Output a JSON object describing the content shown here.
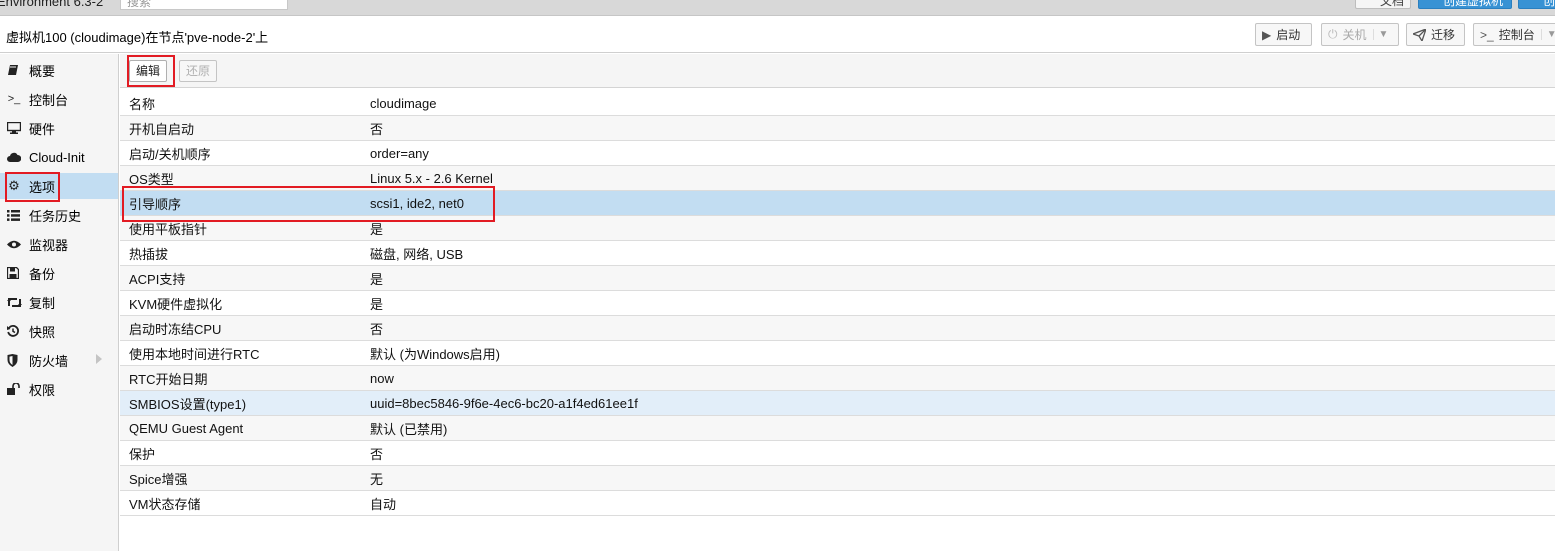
{
  "topbar": {
    "env_text": "Environment 6.3-2",
    "search_placeholder": "搜索",
    "btn_docs": "文档",
    "btn_create_vm": "创建虚拟机",
    "btn_create_ct": "创"
  },
  "titlebar": {
    "title": "虚拟机100 (cloudimage)在节点'pve-node-2'上",
    "start_label": "启动",
    "shutdown_label": "关机",
    "migrate_label": "迁移",
    "console_label": "控制台"
  },
  "sidebar": {
    "items": [
      {
        "label": "概要",
        "icon": "book-icon"
      },
      {
        "label": "控制台",
        "icon": "terminal-icon"
      },
      {
        "label": "硬件",
        "icon": "desktop-icon"
      },
      {
        "label": "Cloud-Init",
        "icon": "cloud-icon"
      },
      {
        "label": "选项",
        "icon": "gear-icon",
        "active": true
      },
      {
        "label": "任务历史",
        "icon": "list-icon"
      },
      {
        "label": "监视器",
        "icon": "eye-icon"
      },
      {
        "label": "备份",
        "icon": "floppy-icon"
      },
      {
        "label": "复制",
        "icon": "retweet-icon"
      },
      {
        "label": "快照",
        "icon": "history-icon"
      },
      {
        "label": "防火墙",
        "icon": "shield-icon"
      },
      {
        "label": "权限",
        "icon": "unlock-icon"
      }
    ]
  },
  "toolbar": {
    "edit_label": "编辑",
    "revert_label": "还原"
  },
  "options": [
    {
      "key": "名称",
      "value": "cloudimage"
    },
    {
      "key": "开机自启动",
      "value": "否"
    },
    {
      "key": "启动/关机顺序",
      "value": "order=any"
    },
    {
      "key": "OS类型",
      "value": "Linux 5.x - 2.6 Kernel"
    },
    {
      "key": "引导顺序",
      "value": "scsi1, ide2, net0"
    },
    {
      "key": "使用平板指针",
      "value": "是"
    },
    {
      "key": "热插拔",
      "value": "磁盘, 网络, USB"
    },
    {
      "key": "ACPI支持",
      "value": "是"
    },
    {
      "key": "KVM硬件虚拟化",
      "value": "是"
    },
    {
      "key": "启动时冻结CPU",
      "value": "否"
    },
    {
      "key": "使用本地时间进行RTC",
      "value": "默认 (为Windows启用)"
    },
    {
      "key": "RTC开始日期",
      "value": "now"
    },
    {
      "key": "SMBIOS设置(type1)",
      "value": "uuid=8bec5846-9f6e-4ec6-bc20-a1f4ed61ee1f"
    },
    {
      "key": "QEMU Guest Agent",
      "value": "默认 (已禁用)"
    },
    {
      "key": "保护",
      "value": "否"
    },
    {
      "key": "Spice增强",
      "value": "无"
    },
    {
      "key": "VM状态存储",
      "value": "自动"
    }
  ],
  "colors": {
    "selected_row": "#c2ddf2",
    "highlight_box": "#e21b23",
    "primary_button": "#3892d4"
  }
}
